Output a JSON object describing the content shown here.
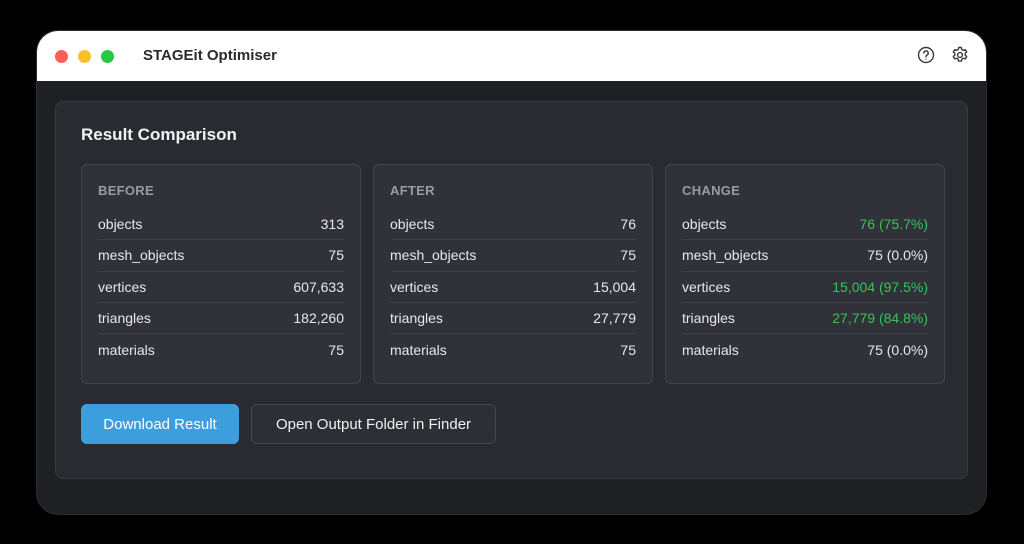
{
  "window": {
    "title": "STAGEit Optimiser",
    "icons": [
      "help-icon",
      "gear-icon"
    ]
  },
  "panel": {
    "title": "Result Comparison"
  },
  "cards": [
    {
      "header": "BEFORE",
      "rows": [
        {
          "label": "objects",
          "value": "313"
        },
        {
          "label": "mesh_objects",
          "value": "75"
        },
        {
          "label": "vertices",
          "value": "607,633"
        },
        {
          "label": "triangles",
          "value": "182,260"
        },
        {
          "label": "materials",
          "value": "75"
        }
      ]
    },
    {
      "header": "AFTER",
      "rows": [
        {
          "label": "objects",
          "value": "76"
        },
        {
          "label": "mesh_objects",
          "value": "75"
        },
        {
          "label": "vertices",
          "value": "15,004"
        },
        {
          "label": "triangles",
          "value": "27,779"
        },
        {
          "label": "materials",
          "value": "75"
        }
      ]
    },
    {
      "header": "CHANGE",
      "rows": [
        {
          "label": "objects",
          "value": "76 (75.7%)",
          "status": "reduced"
        },
        {
          "label": "mesh_objects",
          "value": "75 (0.0%)",
          "status": "unchanged"
        },
        {
          "label": "vertices",
          "value": "15,004 (97.5%)",
          "status": "reduced"
        },
        {
          "label": "triangles",
          "value": "27,779 (84.8%)",
          "status": "reduced"
        },
        {
          "label": "materials",
          "value": "75 (0.0%)",
          "status": "unchanged"
        }
      ]
    }
  ],
  "actions": {
    "download_label": "Download Result",
    "open_folder_label": "Open Output Folder in Finder"
  },
  "colors": {
    "accent": "#3d9ede",
    "reduced": "#35c35a"
  }
}
